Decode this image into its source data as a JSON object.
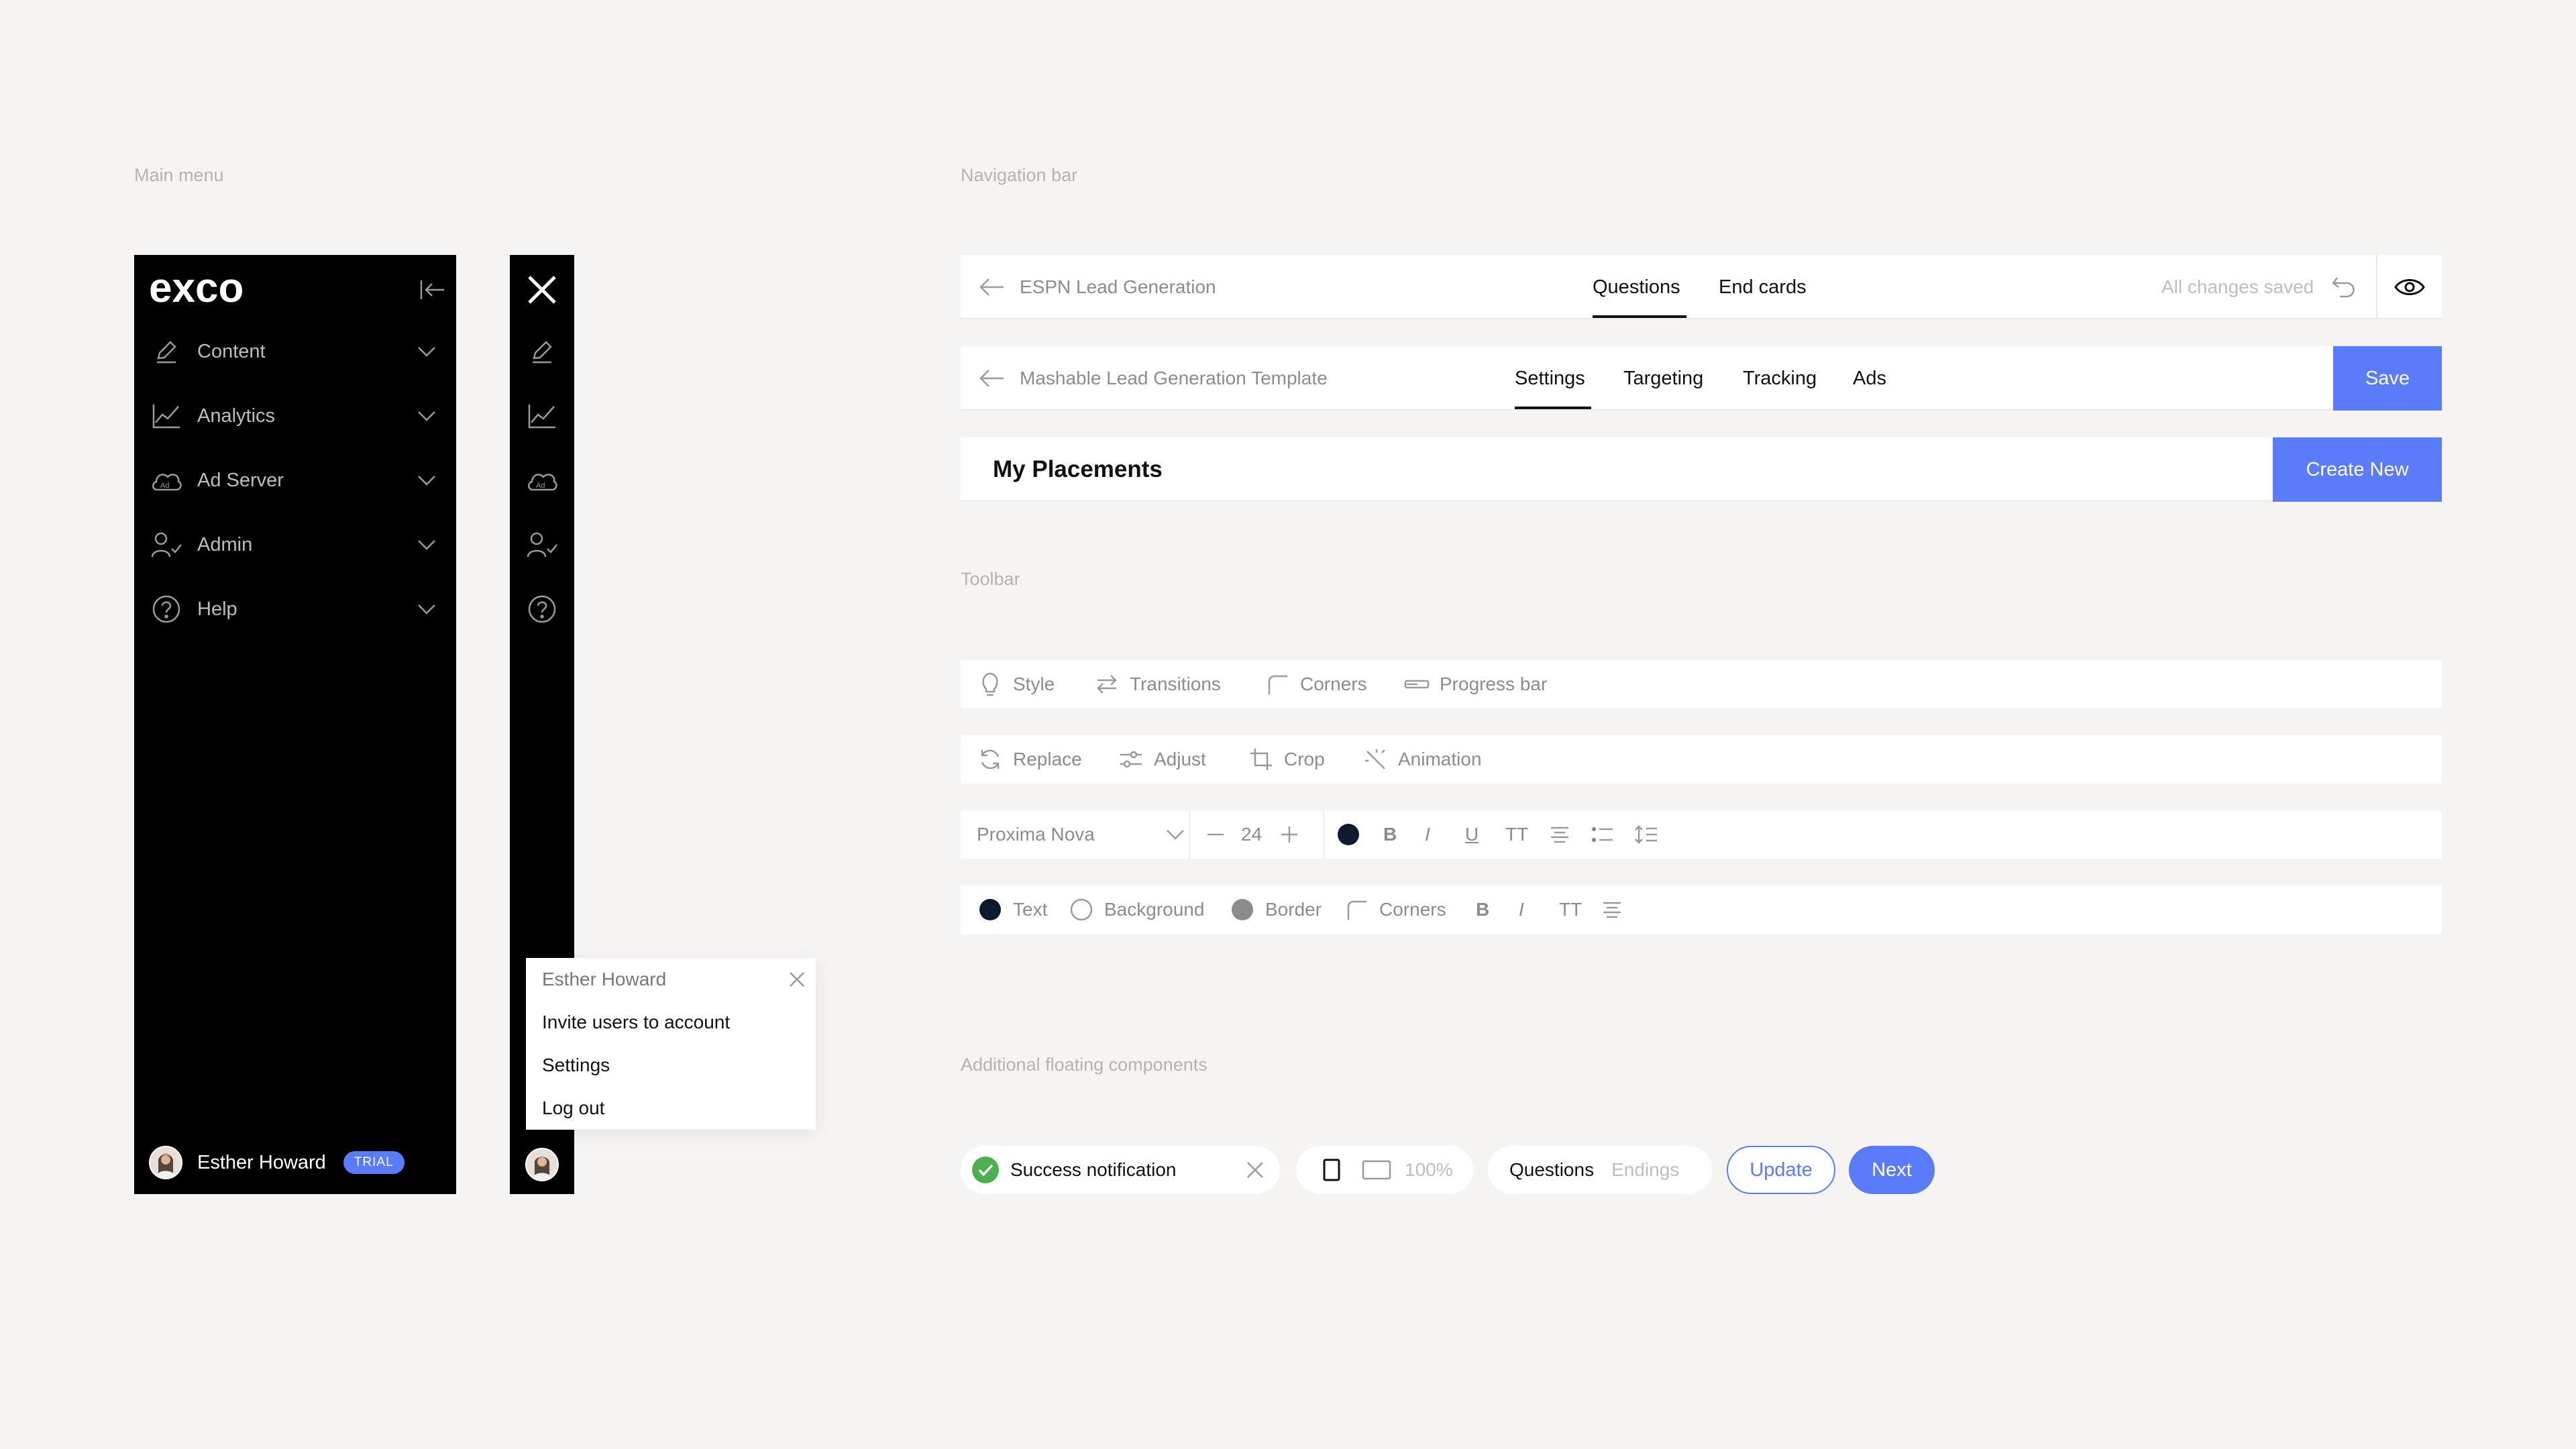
{
  "labels": {
    "main_menu": "Main menu",
    "navigation_bar": "Navigation bar",
    "toolbar": "Toolbar",
    "floating": "Additional floating components"
  },
  "sidebar": {
    "logo": "exco",
    "items": [
      {
        "label": "Content",
        "icon": "pencil-icon"
      },
      {
        "label": "Analytics",
        "icon": "chart-line-icon"
      },
      {
        "label": "Ad Server",
        "icon": "cloud-ad-icon"
      },
      {
        "label": "Admin",
        "icon": "user-check-icon"
      },
      {
        "label": "Help",
        "icon": "help-circle-icon"
      }
    ],
    "user_name": "Esther Howard",
    "badge": "TRIAL"
  },
  "popup": {
    "title": "Esther Howard",
    "items": [
      "Invite users to account",
      "Settings",
      "Log out"
    ]
  },
  "nav1": {
    "title": "ESPN Lead Generation",
    "tabs": [
      "Questions",
      "End cards"
    ],
    "status": "All changes saved"
  },
  "nav2": {
    "title": "Mashable Lead Generation Template",
    "tabs": [
      "Settings",
      "Targeting",
      "Tracking",
      "Ads"
    ],
    "save": "Save"
  },
  "nav3": {
    "title": "My Placements",
    "create": "Create New"
  },
  "toolbar1": [
    "Style",
    "Transitions",
    "Corners",
    "Progress bar"
  ],
  "toolbar2": [
    "Replace",
    "Adjust",
    "Crop",
    "Animation"
  ],
  "toolbar3": {
    "font": "Proxima Nova",
    "size": "24",
    "color": "#0d1b2e"
  },
  "toolbar4": {
    "text": "Text",
    "background": "Background",
    "border": "Border",
    "corners": "Corners"
  },
  "floating": {
    "success": "Success notification",
    "zoom": "100%",
    "questions": "Questions",
    "endings": "Endings",
    "update": "Update",
    "next": "Next"
  },
  "colors": {
    "accent": "#5b7cfa",
    "success": "#4caf50",
    "sidebar_bg": "#000000",
    "page_bg": "#f6f4f2"
  }
}
